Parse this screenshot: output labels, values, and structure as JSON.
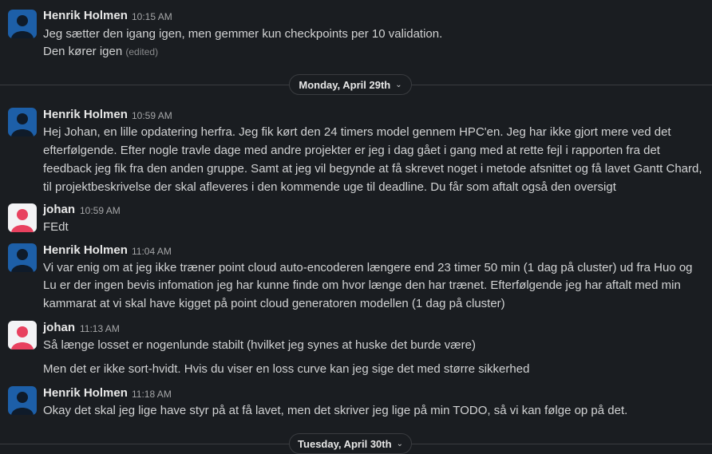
{
  "colors": {
    "background": "#1a1d21",
    "henrik_avatar": "#1d5fa8",
    "johan_avatar": "#e8415f"
  },
  "messages": [
    {
      "author": "Henrik Holmen",
      "time": "10:15 AM",
      "lines": [
        "Jeg sætter den igang igen, men gemmer kun checkpoints per 10 validation.",
        "Den kører igen"
      ],
      "edited": "(edited)"
    },
    {
      "author": "Henrik Holmen",
      "time": "10:59 AM",
      "lines": [
        "Hej Johan, en lille opdatering herfra. Jeg fik kørt den 24 timers model gennem  HPC'en. Jeg har ikke gjort mere ved det",
        "efterfølgende. Efter nogle travle dage med andre projekter er jeg i dag gået i gang med at rette fejl i rapporten fra det",
        "feedback jeg fik fra den anden gruppe. Samt at jeg vil begynde at få skrevet noget i metode afsnittet og få lavet Gantt Chard,",
        "til projektbeskrivelse  der skal afleveres i den kommende uge til deadline. Du får som aftalt også den oversigt"
      ]
    },
    {
      "author": "johan",
      "time": "10:59 AM",
      "lines": [
        "FEdt"
      ]
    },
    {
      "author": "Henrik Holmen",
      "time": "11:04 AM",
      "lines": [
        "Vi var enig om at jeg ikke træner point cloud auto-encoderen længere end 23 timer 50 min (1 dag på cluster) ud fra Huo og",
        "Lu er der ingen bevis infomation jeg har kunne finde om hvor længe den har trænet. Efterfølgende jeg har aftalt med min",
        "kammarat at vi skal have kigget på point cloud generatoren modellen (1 dag på cluster)"
      ]
    },
    {
      "author": "johan",
      "time": "11:13 AM",
      "lines": [
        "Så længe losset er nogenlunde stabilt (hvilket jeg synes at huske det burde være)",
        "Men det er ikke sort-hvidt. Hvis du viser en loss curve kan jeg sige det med større sikkerhed"
      ]
    },
    {
      "author": "Henrik Holmen",
      "time": "11:18 AM",
      "lines": [
        "Okay det skal jeg lige have styr på at få lavet, men det skriver jeg lige på min TODO, så vi kan følge op på det."
      ]
    }
  ],
  "dividers": [
    {
      "label": "Monday, April 29th",
      "icon": "chevron-down-icon"
    },
    {
      "label": "Tuesday, April 30th",
      "icon": "chevron-down-icon"
    }
  ]
}
